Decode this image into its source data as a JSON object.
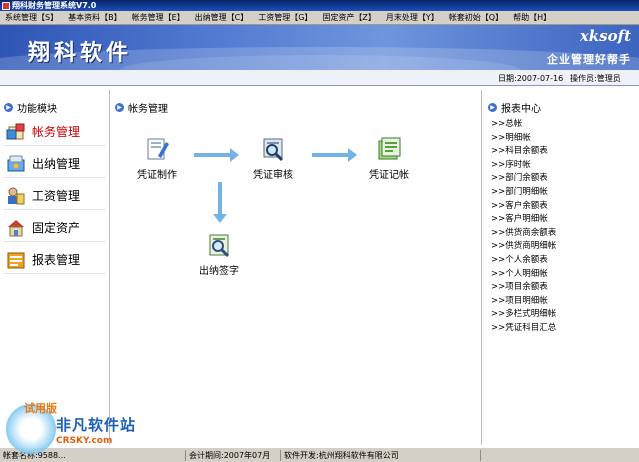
{
  "window": {
    "title": "翔科财务管理系统V7.0"
  },
  "menu": [
    "系统管理【S】",
    "基本资料【B】",
    "帐务管理【E】",
    "出纳管理【C】",
    "工资管理【G】",
    "固定资产【Z】",
    "月末处理【Y】",
    "帐套初始【Q】",
    "帮助【H】"
  ],
  "banner": {
    "logo": "翔科软件",
    "brand_en": "xksoft",
    "slogan": "企业管理好帮手"
  },
  "info": {
    "date": "日期:2007-07-16",
    "operator": "操作员:管理员"
  },
  "left": {
    "title": "功能模块",
    "modules": [
      {
        "label": "帐务管理",
        "active": true
      },
      {
        "label": "出纳管理",
        "active": false
      },
      {
        "label": "工资管理",
        "active": false
      },
      {
        "label": "固定资产",
        "active": false
      },
      {
        "label": "报表管理",
        "active": false
      }
    ]
  },
  "center": {
    "title": "帐务管理",
    "nodes": {
      "voucher_make": "凭证制作",
      "voucher_audit": "凭证审核",
      "voucher_post": "凭证记帐",
      "cashier_sign": "出纳签字"
    }
  },
  "right": {
    "title": "报表中心",
    "reports": [
      ">>总帐",
      ">>明细帐",
      ">>科目余额表",
      ">>序时帐",
      ">>部门余额表",
      ">>部门明细帐",
      ">>客户余额表",
      ">>客户明细帐",
      ">>供货商余额表",
      ">>供货商明细帐",
      ">>个人余额表",
      ">>个人明细帐",
      ">>项目余额表",
      ">>项目明细帐",
      ">>多栏式明细帐",
      ">>凭证科目汇总"
    ]
  },
  "status": {
    "left": "帐套名称:9588...",
    "period": "会计期间:2007年07月",
    "developer": "软件开发:杭州翔科软件有限公司"
  },
  "watermark": {
    "trial": "试用版",
    "name": "非凡软件站",
    "url": "CRSKY.com"
  },
  "colors": {
    "active_module": "#c00000",
    "flow_arrow": "#74b3e6",
    "banner": "#3c64c0"
  }
}
